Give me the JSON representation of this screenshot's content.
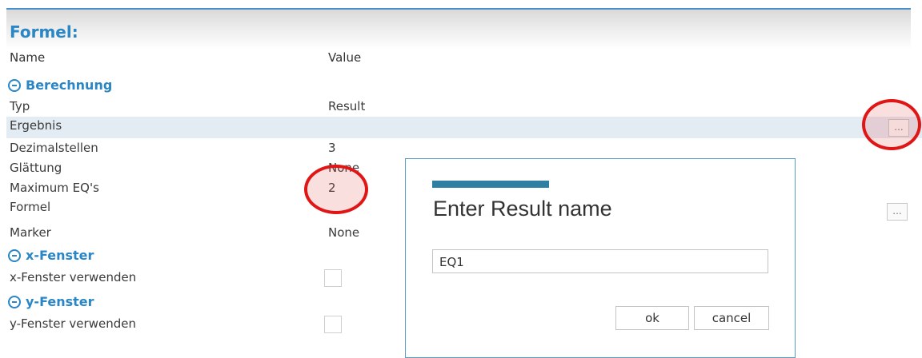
{
  "header": {
    "title": "Formel:",
    "col_name": "Name",
    "col_value": "Value"
  },
  "sections": {
    "berechnung": "Berechnung",
    "x_fenster": "x-Fenster",
    "y_fenster": "y-Fenster"
  },
  "rows": {
    "typ": {
      "label": "Typ",
      "value": "Result"
    },
    "ergebnis": {
      "label": "Ergebnis",
      "value": ""
    },
    "dezimal": {
      "label": "Dezimalstellen",
      "value": "3"
    },
    "glaettung": {
      "label": "Glättung",
      "value": "None"
    },
    "max_eq": {
      "label": "Maximum EQ's",
      "value": "2"
    },
    "formel": {
      "label": "Formel",
      "value": ""
    },
    "marker": {
      "label": "Marker",
      "value": "None"
    },
    "x_use": {
      "label": "x-Fenster verwenden"
    },
    "y_use": {
      "label": "y-Fenster verwenden"
    }
  },
  "ellipsis": "...",
  "dialog": {
    "title": "Enter Result name",
    "input_value": "EQ1",
    "ok_label": "ok",
    "cancel_label": "cancel"
  },
  "colors": {
    "accent": "#2a86c5",
    "highlight_row": "#e3ebf3",
    "annotation": "#e01616",
    "dialog_bar": "#2f7fa3"
  }
}
